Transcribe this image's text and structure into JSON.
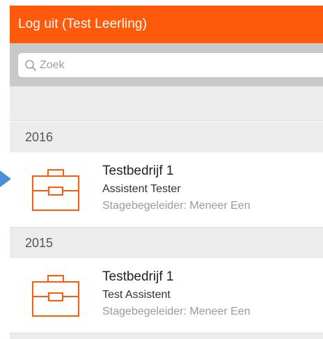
{
  "header": {
    "title": "Log uit (Test Leerling)"
  },
  "search": {
    "placeholder": "Zoek",
    "value": ""
  },
  "sections": [
    {
      "year": "2016",
      "items": [
        {
          "company": "Testbedrijf 1",
          "role": "Assistent Tester",
          "supervisor": "Stagebegeleider: Meneer Een"
        }
      ]
    },
    {
      "year": "2015",
      "items": [
        {
          "company": "Testbedrijf 1",
          "role": "Test Assistent",
          "supervisor": "Stagebegeleider: Meneer Een"
        }
      ]
    }
  ],
  "colors": {
    "accent": "#ff5a0a",
    "band": "#ececec",
    "search_bar": "#c9c9c9",
    "pointer": "#4a8fd8"
  },
  "icons": {
    "item": "briefcase-icon",
    "search": "search-icon",
    "pointer": "pointer-arrow-icon"
  }
}
